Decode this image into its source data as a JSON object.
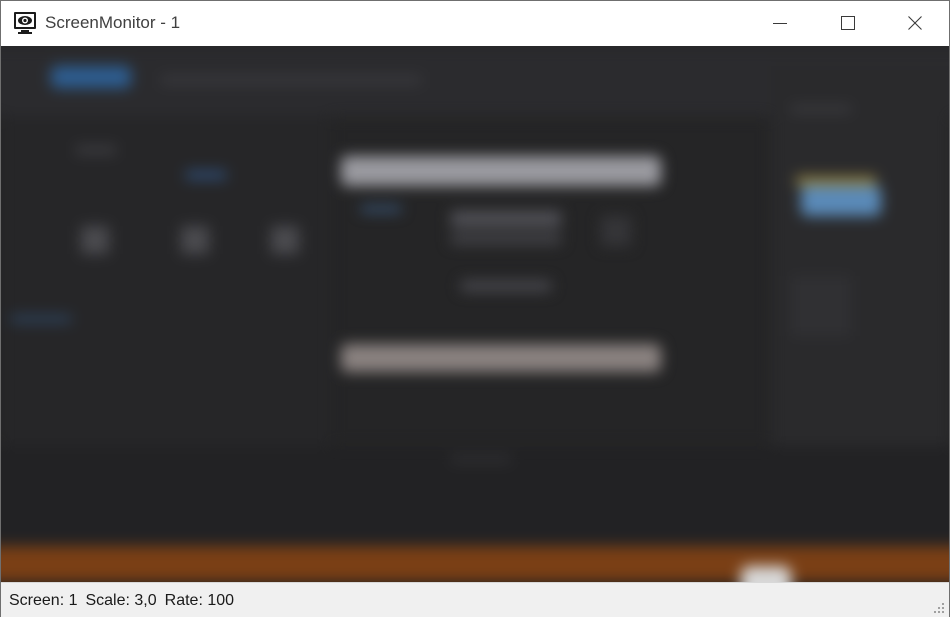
{
  "window": {
    "title": "ScreenMonitor - 1"
  },
  "titlebar_buttons": {
    "minimize_icon": "minimize-icon",
    "maximize_icon": "maximize-icon",
    "close_icon": "close-icon"
  },
  "status": {
    "screen": "Screen: 1",
    "scale": "Scale: 3,0",
    "rate": "Rate: 100"
  },
  "colors": {
    "viewport_background": "#252526",
    "statusbar_background": "#f0f0f0",
    "accent_blue": "#3a7cc0",
    "orange_band": "#8a4a1a"
  }
}
